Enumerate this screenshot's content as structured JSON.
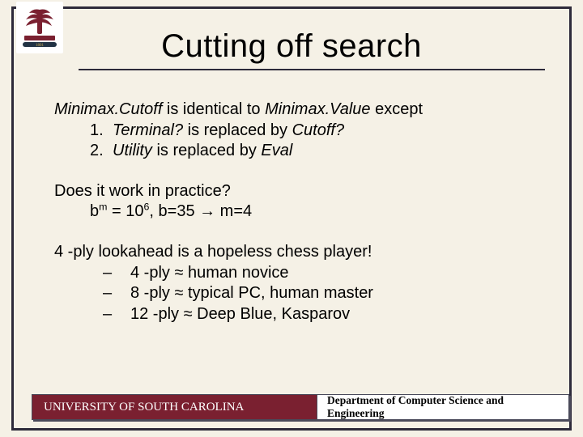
{
  "title": "Cutting off search",
  "p1": {
    "line1a": "Minimax.Cutoff",
    "line1b": " is identical to ",
    "line1c": "Minimax.Value",
    "line1d": " except",
    "item1_num": "1.",
    "item1a": "Terminal?",
    "item1b": " is replaced by ",
    "item1c": "Cutoff?",
    "item2_num": "2.",
    "item2a": "Utility",
    "item2b": " is replaced by ",
    "item2c": "Eval"
  },
  "p2": {
    "line1": "Does it work in practice?",
    "line2a": "b",
    "line2b": "m",
    "line2c": " = 10",
    "line2d": "6",
    "line2e": ", b=35 → m=4"
  },
  "p3": {
    "line1": "4 -ply lookahead is a hopeless chess player!",
    "dash": "–",
    "item1": "4 -ply ≈ human novice",
    "item2": "8 -ply ≈ typical PC, human master",
    "item3": "12 -ply ≈ Deep Blue, Kasparov"
  },
  "footer": {
    "left": "UNIVERSITY OF SOUTH CAROLINA",
    "right": "Department of Computer Science and Engineering"
  }
}
